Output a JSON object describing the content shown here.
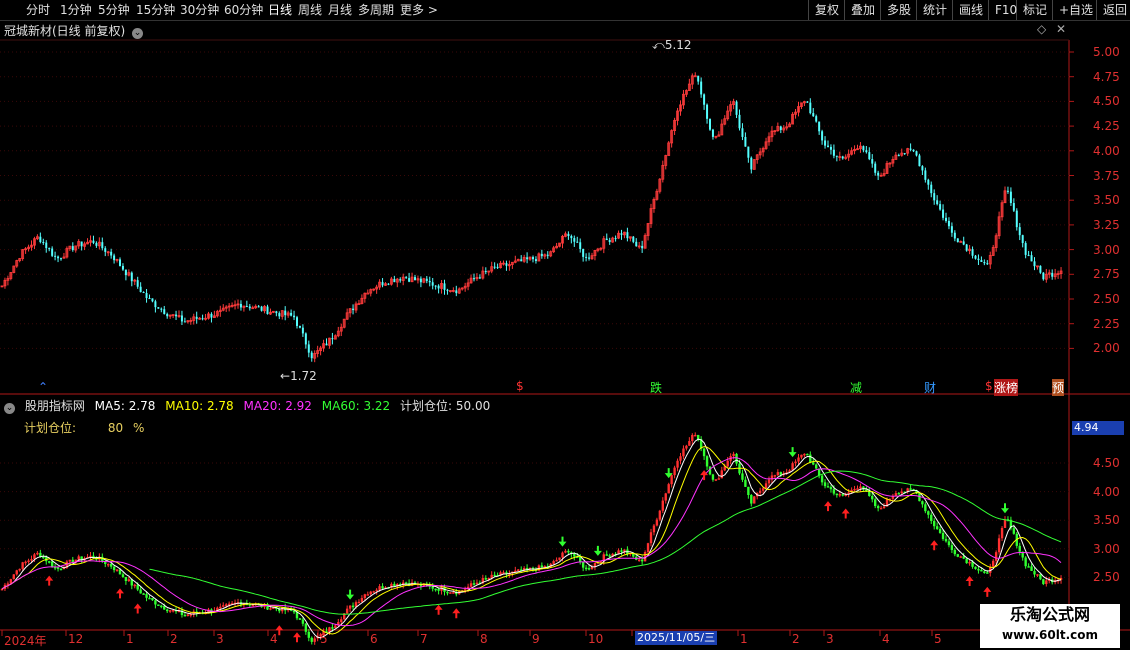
{
  "toolbar": {
    "periods": [
      "分时",
      "1分钟",
      "5分钟",
      "15分钟",
      "30分钟",
      "60分钟",
      "日线",
      "周线",
      "月线",
      "多周期",
      "更多 >"
    ],
    "active_period": "日线",
    "right_buttons": [
      "复权",
      "叠加",
      "多股",
      "统计",
      "画线",
      "F10",
      "标记",
      "+自选",
      "返回"
    ]
  },
  "main": {
    "title": "冠城新材(日线 前复权)",
    "high_label": "5.12",
    "low_label": "1.72",
    "y_ticks": [
      "5.00",
      "4.75",
      "4.50",
      "4.25",
      "4.00",
      "3.75",
      "3.50",
      "3.25",
      "3.00",
      "2.75",
      "2.50",
      "2.25",
      "2.00"
    ],
    "event_markers": [
      {
        "text": "$",
        "color": "#ff3333"
      },
      {
        "text": "跌",
        "color": "#33ff33"
      },
      {
        "text": "减",
        "color": "#33ff33"
      },
      {
        "text": "财",
        "color": "#3399ff"
      },
      {
        "text": "$",
        "color": "#ff3333"
      },
      {
        "text": "涨榜",
        "color": "#ffffff"
      },
      {
        "text": "预",
        "color": "#ffffff"
      }
    ]
  },
  "indicator": {
    "name": "股朋指标网",
    "ma5": "MA5: 2.78",
    "ma10": "MA10: 2.78",
    "ma20": "MA20: 2.92",
    "ma60": "MA60: 3.22",
    "plan": "计划仓位: 50.00",
    "plan_label": "计划仓位:",
    "plan_value": "80",
    "plan_unit": "%",
    "price_tag": "4.94",
    "y_ticks": [
      "4.50",
      "4.00",
      "3.50",
      "3.00",
      "2.50"
    ],
    "colors": {
      "ma5": "#ffffff",
      "ma10": "#ffff00",
      "ma20": "#ff33ff",
      "ma60": "#33ff33"
    }
  },
  "x_axis": {
    "labels": [
      "2024年",
      "12",
      "1",
      "2",
      "3",
      "4",
      "5",
      "6",
      "7",
      "8",
      "9",
      "10",
      "11",
      "1",
      "2",
      "3",
      "4",
      "5"
    ],
    "cursor_date": "2025/11/05/三"
  },
  "watermark": {
    "line1": "乐淘公式网",
    "line2": "www.60lt.com"
  },
  "chart_data": {
    "type": "candlestick",
    "title": "冠城新材(日线 前复权)",
    "ylim": [
      1.6,
      5.3
    ],
    "high": 5.12,
    "low": 1.72,
    "close_path": [
      2.6,
      2.95,
      3.15,
      2.9,
      3.05,
      3.1,
      2.95,
      2.7,
      2.45,
      2.3,
      2.2,
      2.25,
      2.3,
      2.4,
      2.35,
      2.3,
      2.25,
      1.8,
      2.0,
      2.3,
      2.55,
      2.65,
      2.7,
      2.65,
      2.6,
      2.55,
      2.7,
      2.8,
      2.85,
      2.9,
      2.95,
      3.2,
      2.9,
      3.1,
      3.2,
      3.0,
      3.8,
      4.6,
      5.0,
      4.2,
      4.7,
      3.9,
      4.3,
      4.4,
      4.7,
      4.2,
      4.0,
      4.2,
      3.8,
      4.1,
      4.1,
      3.6,
      3.2,
      3.0,
      2.8,
      3.7,
      3.0,
      2.7,
      2.78
    ]
  }
}
